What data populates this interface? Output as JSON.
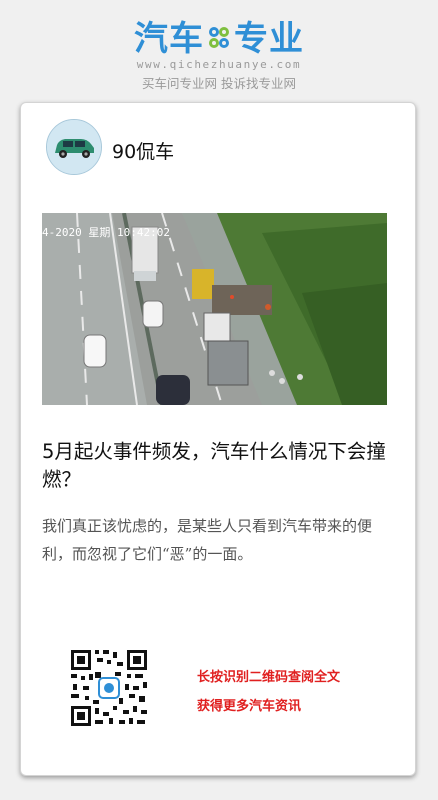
{
  "site": {
    "logo_left": "汽车",
    "logo_right": "专业",
    "domain": "www.qichezhuanye.com",
    "slogan": "买车问专业网 投诉找专业网",
    "brand_color": "#2f8fd6"
  },
  "article": {
    "author": "90侃车",
    "image_overlay": "4-2020 星期 10:42:02",
    "title": "5月起火事件频发，汽车什么情况下会撞燃？",
    "summary": "我们真正该忧虑的，是某些人只看到汽车带来的便利，而忽视了它们“恶”的一面。"
  },
  "promo": {
    "line1": "长按识别二维码查阅全文",
    "line2": "获得更多汽车资讯",
    "accent_color": "#e02020"
  }
}
